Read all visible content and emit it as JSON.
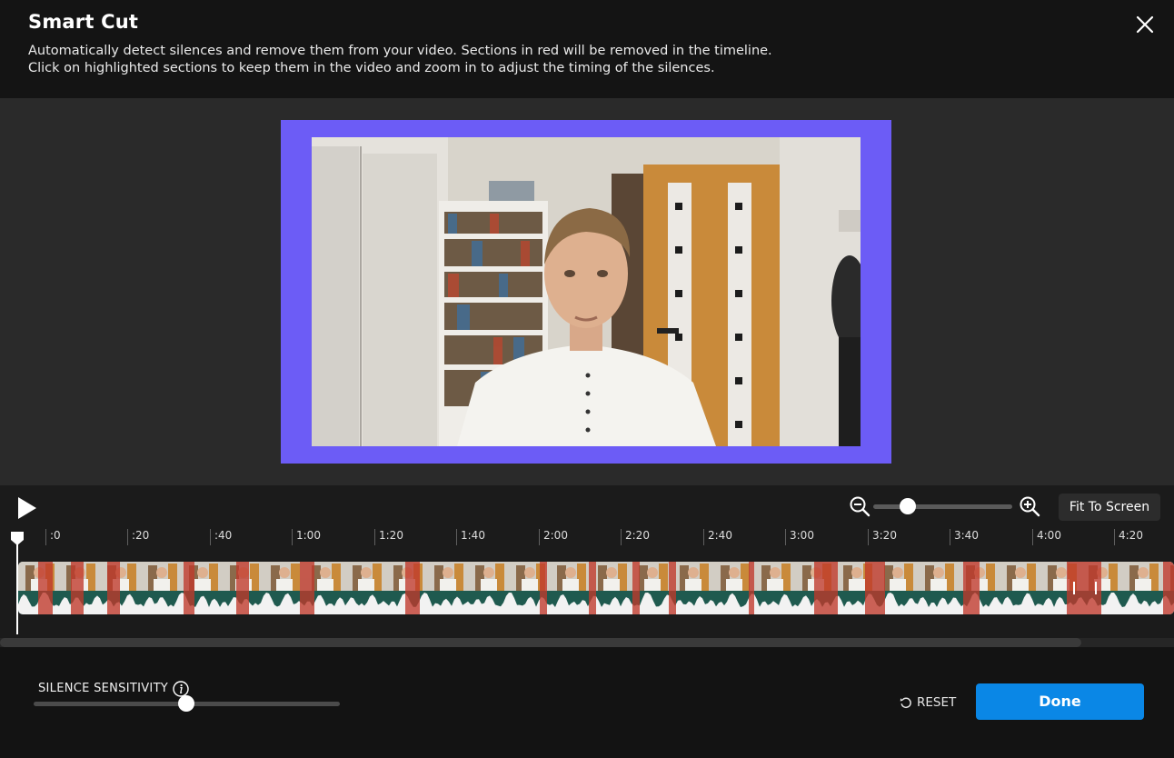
{
  "dialog": {
    "title": "Smart Cut",
    "description_line1": "Automatically detect silences and remove them from your video. Sections in red will be removed in the timeline.",
    "description_line2": "Click on highlighted sections to keep them in the video and zoom in to adjust the timing of the silences."
  },
  "preview": {
    "frame_color": "#6c5cf6"
  },
  "toolbar": {
    "fit_to_screen_label": "Fit To Screen",
    "zoom_level": 0.25
  },
  "timeline": {
    "ticks": [
      ":0",
      ":20",
      ":40",
      "1:00",
      "1:20",
      "1:40",
      "2:00",
      "2:20",
      "2:40",
      "3:00",
      "3:20",
      "3:40",
      "4:00",
      "4:20"
    ],
    "playhead_position": 0,
    "silence_color": "#c0392b",
    "waveform_color": "#1f5a4f"
  },
  "sensitivity": {
    "label": "SILENCE SENSITIVITY",
    "value": 0.5
  },
  "actions": {
    "reset_label": "RESET",
    "done_label": "Done",
    "done_color": "#0a87e6"
  },
  "icons": {
    "close": "close-icon",
    "play": "play-icon",
    "zoom_out": "zoom-out-icon",
    "zoom_in": "zoom-in-icon",
    "info": "info-icon",
    "reset": "reset-icon"
  }
}
